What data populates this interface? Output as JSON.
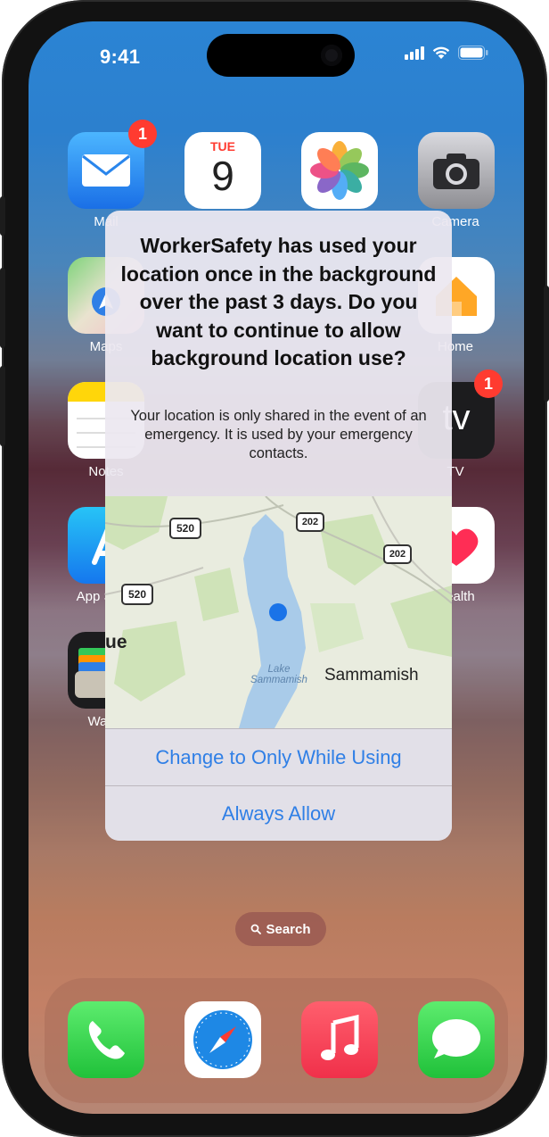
{
  "status_bar": {
    "time": "9:41"
  },
  "apps": {
    "mail": {
      "label": "Mail",
      "badge": "1"
    },
    "calendar": {
      "day": "TUE",
      "date": "9"
    },
    "photos": {},
    "camera": {
      "label": "Camera"
    },
    "maps": {
      "label": "Maps"
    },
    "home": {
      "label": "Home"
    },
    "notes": {
      "label": "Notes"
    },
    "tv": {
      "label": "TV",
      "badge": "1",
      "glyph": "tv"
    },
    "app_store": {
      "label": "App Store"
    },
    "health": {
      "label": "Health"
    },
    "wallet": {
      "label": "Wallet"
    }
  },
  "alert": {
    "title": "WorkerSafety has used your location once in the background over the past 3 days. Do you want to continue to allow background location use?",
    "message": "Your location is only shared in the event of an emergency. It is used by your emergency contacts.",
    "map": {
      "left_edge_text": "ue",
      "place_label": "Sammamish",
      "water_label_1": "Lake",
      "water_label_2": "Sammamish",
      "shields": [
        "520",
        "202",
        "202",
        "520"
      ]
    },
    "buttons": {
      "change": "Change to Only While Using",
      "always": "Always Allow"
    }
  },
  "search": {
    "label": "Search"
  },
  "dock": [
    "Phone",
    "Safari",
    "Music",
    "Messages"
  ],
  "colors": {
    "accent": "#2f7fe6",
    "badge": "#ff3b30"
  }
}
